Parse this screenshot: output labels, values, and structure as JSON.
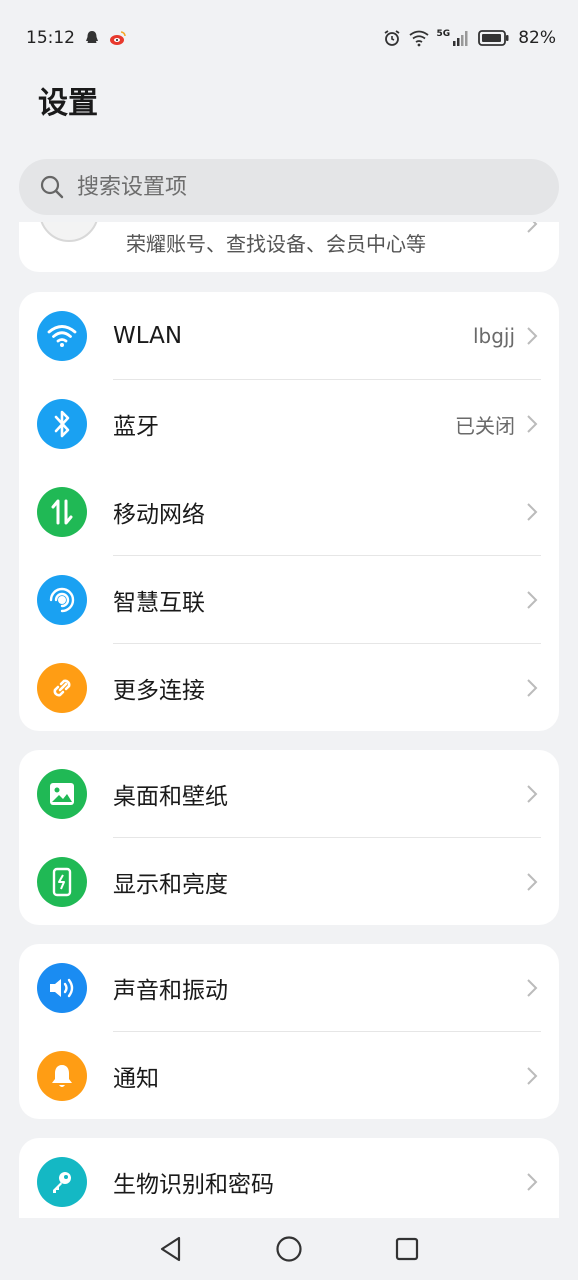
{
  "status_bar": {
    "time": "15:12",
    "network": "5G",
    "battery": "82%"
  },
  "header": {
    "title": "设置"
  },
  "search": {
    "placeholder": "搜索设置项"
  },
  "account": {
    "subtitle": "荣耀账号、查找设备、会员中心等"
  },
  "groups": [
    {
      "items": [
        {
          "label": "WLAN",
          "value": "lbgjj",
          "icon": "wifi-icon",
          "color": "#1aa1f2"
        },
        {
          "label": "蓝牙",
          "value": "已关闭",
          "icon": "bluetooth-icon",
          "color": "#1aa1f2"
        },
        {
          "label": "移动网络",
          "value": "",
          "icon": "mobile-data-icon",
          "color": "#20b955"
        },
        {
          "label": "智慧互联",
          "value": "",
          "icon": "smart-connect-icon",
          "color": "#1aa1f2"
        },
        {
          "label": "更多连接",
          "value": "",
          "icon": "link-icon",
          "color": "#ff9d14"
        }
      ]
    },
    {
      "items": [
        {
          "label": "桌面和壁纸",
          "value": "",
          "icon": "wallpaper-icon",
          "color": "#20b955"
        },
        {
          "label": "显示和亮度",
          "value": "",
          "icon": "display-icon",
          "color": "#20b955"
        }
      ]
    },
    {
      "items": [
        {
          "label": "声音和振动",
          "value": "",
          "icon": "sound-icon",
          "color": "#1a8cf2"
        },
        {
          "label": "通知",
          "value": "",
          "icon": "bell-icon",
          "color": "#ff9d14"
        }
      ]
    },
    {
      "items": [
        {
          "label": "生物识别和密码",
          "value": "",
          "icon": "key-icon",
          "color": "#14b8c4"
        }
      ]
    }
  ]
}
